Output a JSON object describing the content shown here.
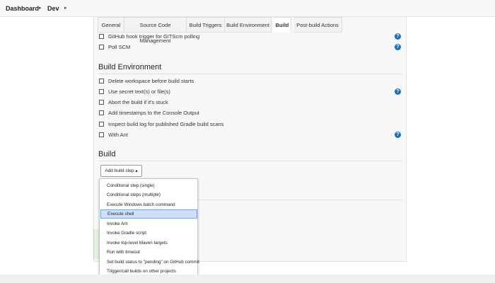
{
  "breadcrumb": {
    "items": [
      "Dashboard",
      "Dev"
    ],
    "separator": "▸"
  },
  "tabs": [
    {
      "label": "General"
    },
    {
      "label": "Source Code Management"
    },
    {
      "label": "Build Triggers"
    },
    {
      "label": "Build Environment"
    },
    {
      "label": "Build"
    },
    {
      "label": "Post-build Actions"
    }
  ],
  "active_tab": "Build",
  "triggers": {
    "options": [
      {
        "label": "GitHub hook trigger for GITScm polling",
        "checked": false,
        "help": true
      },
      {
        "label": "Poll SCM",
        "checked": false,
        "help": true
      }
    ]
  },
  "build_environment": {
    "title": "Build Environment",
    "options": [
      {
        "label": "Delete workspace before build starts",
        "checked": false,
        "help": false
      },
      {
        "label": "Use secret text(s) or file(s)",
        "checked": false,
        "help": true
      },
      {
        "label": "Abort the build if it's stuck",
        "checked": false,
        "help": false
      },
      {
        "label": "Add timestamps to the Console Output",
        "checked": false,
        "help": false
      },
      {
        "label": "Inspect build log for published Gradle build scans",
        "checked": false,
        "help": false
      },
      {
        "label": "With Ant",
        "checked": false,
        "help": true
      }
    ]
  },
  "build": {
    "title": "Build",
    "add_button_label": "Add build step ▴",
    "menu_items": [
      {
        "label": "Conditional step (single)"
      },
      {
        "label": "Conditional steps (multiple)"
      },
      {
        "label": "Execute Windows batch command"
      },
      {
        "label": "Execute shell"
      },
      {
        "label": "Invoke Ant"
      },
      {
        "label": "Invoke Gradle script"
      },
      {
        "label": "Invoke top-level Maven targets"
      },
      {
        "label": "Run with timeout"
      },
      {
        "label": "Set build status to \"pending\" on GitHub commit"
      },
      {
        "label": "Trigger/call builds on other projects"
      }
    ],
    "highlighted_item": "Execute shell"
  },
  "icons": {
    "help": "question-mark-icon",
    "checkbox": "checkbox-icon"
  },
  "colors": {
    "help_icon": "#1f6fb5",
    "menu_highlight": "#cfe0fb",
    "panel_bg": "#f8f8f8"
  }
}
